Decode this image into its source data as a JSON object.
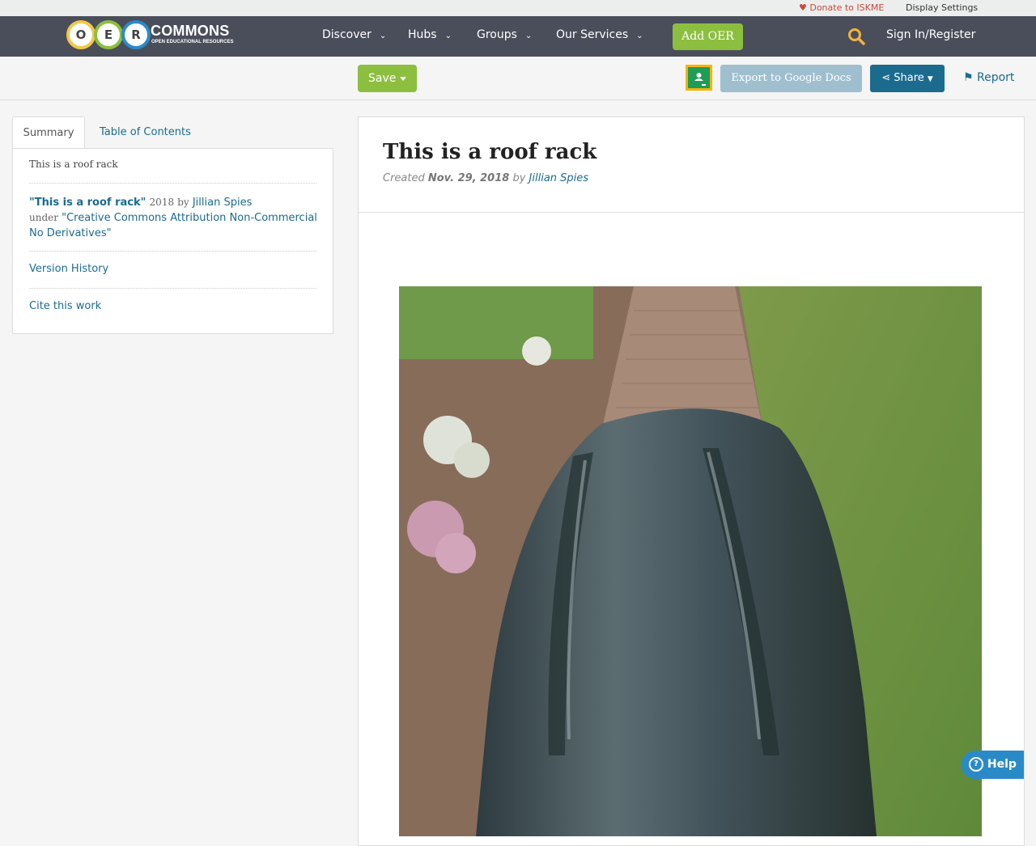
{
  "topbar": {
    "donate_label": "Donate to ISKME",
    "display_settings_label": "Display Settings"
  },
  "header": {
    "logo": {
      "letters": [
        "O",
        "E",
        "R"
      ],
      "brand": "COMMONS",
      "tagline": "OPEN EDUCATIONAL RESOURCES"
    },
    "nav": [
      {
        "label": "Discover"
      },
      {
        "label": "Hubs"
      },
      {
        "label": "Groups"
      },
      {
        "label": "Our Services"
      }
    ],
    "add_oer_label": "Add OER",
    "sign_in_label": "Sign In/Register",
    "icons": {
      "search": "search-icon",
      "chevron": "chevron-down-icon"
    }
  },
  "toolbar": {
    "save_label": "Save",
    "export_label": "Export to Google Docs",
    "share_label": "Share",
    "report_label": "Report",
    "icons": {
      "classroom": "google-classroom-icon",
      "share": "share-icon",
      "report": "flag-icon"
    }
  },
  "sidebar": {
    "tabs": [
      {
        "label": "Summary"
      },
      {
        "label": "Table of Contents"
      }
    ],
    "summary_text": "This is a roof rack",
    "attribution": {
      "title": "\"This is a roof rack\"",
      "year": "2018",
      "by": "by",
      "author": "Jillian Spies",
      "under": "under",
      "license": "\"Creative Commons Attribution Non-Commercial No Derivatives\""
    },
    "version_history_label": "Version History",
    "cite_label": "Cite this work"
  },
  "resource": {
    "title": "This is a roof rack",
    "created_label": "Created",
    "created_date": "Nov. 29, 2018",
    "by_label": "by",
    "author": "Jillian Spies",
    "image_subject": "roof rack cargo box on a brick garden path"
  },
  "help": {
    "label": "Help"
  },
  "colors": {
    "navbar": "#4a4e5a",
    "green": "#8cbf3f",
    "link": "#1b6b8f",
    "share": "#1b6b8f",
    "export": "#9fbfcf",
    "donate": "#c84a3c",
    "help": "#2a8ac8"
  }
}
